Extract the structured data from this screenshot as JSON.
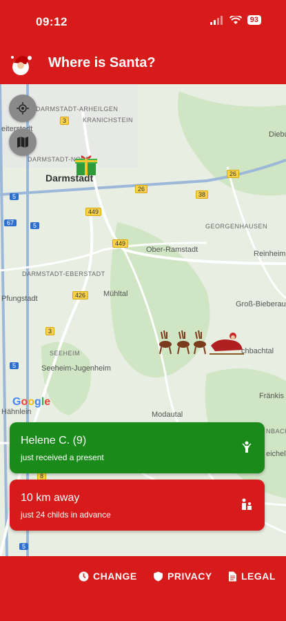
{
  "status_bar": {
    "time": "09:12",
    "battery": "93"
  },
  "app_bar": {
    "title": "Where is Santa?"
  },
  "map": {
    "labels": {
      "arheilgen": "DARMSTADT-ARHEILGEN",
      "kranichstein": "KRANICHSTEIN",
      "weiterstadt": "eiterstadt",
      "darmstadt_nord": "DARMSTADT-NORD",
      "darmstadt": "Darmstadt",
      "diebu": "Diebu",
      "georgenhausen": "GEORGENHAUSEN",
      "ober_ramstadt": "Ober-Ramstadt",
      "reinheim": "Reinheim",
      "eberstadt": "DARMSTADT-EBERSTADT",
      "pfungstadt": "Pfungstadt",
      "muhltal": "Mühltal",
      "gross_bieberau": "Groß-Bieberau",
      "fischbachtal": "chbachtal",
      "seeheim": "SEEHEIM",
      "seeheim_jugenheim": "Seeheim-Jugenheim",
      "frankisch": "Fränkis",
      "hahnlein": "Hähnlein",
      "modautal": "Modautal",
      "nbach": "NBACH",
      "reichelsheim": "eichels"
    },
    "shields": {
      "r3a": "3",
      "r26a": "26",
      "r26b": "26",
      "r38": "38",
      "r449a": "449",
      "r449b": "449",
      "r426": "426",
      "r3b": "3",
      "r8": "8"
    },
    "blue_shields": {
      "b5a": "5",
      "b67": "67",
      "b5b": "5",
      "b5c": "5",
      "b5d": "5"
    },
    "google": "Google",
    "buttons": {
      "locate": "locate-icon",
      "layers": "map-layers-icon"
    }
  },
  "cards": {
    "present": {
      "name": "Helene C. (9)",
      "status": "just received a present"
    },
    "distance": {
      "distance": "10 km away",
      "status": "just 24 childs in advance"
    }
  },
  "bottom_nav": {
    "change": "CHANGE",
    "privacy": "PRIVACY",
    "legal": "LEGAL"
  },
  "colors": {
    "brand_red": "#d71a1a",
    "present_green": "#1a8a1a"
  }
}
